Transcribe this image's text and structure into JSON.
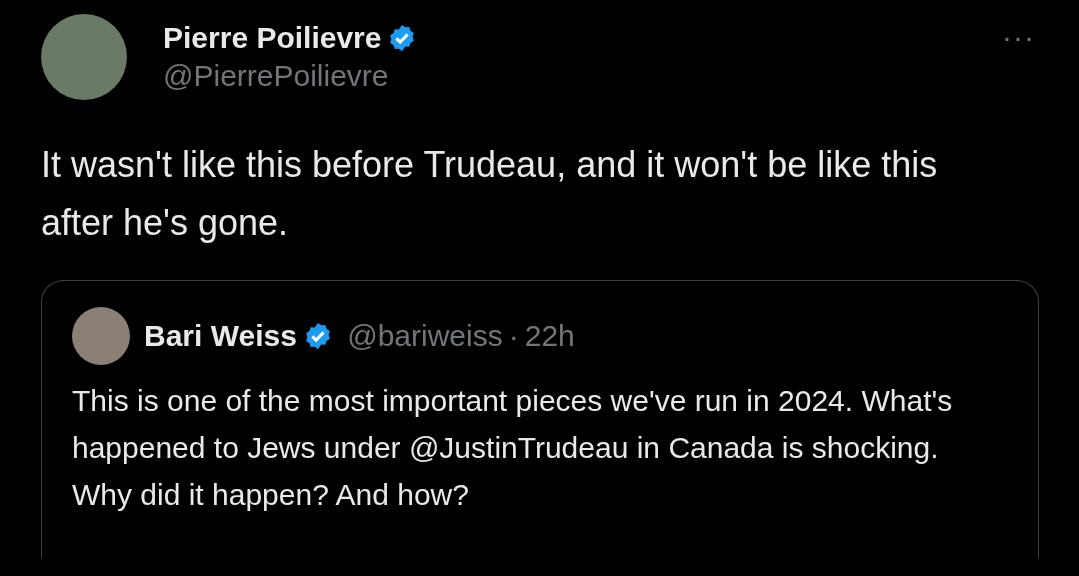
{
  "author": {
    "name": "Pierre Poilievre",
    "verified": true,
    "handle": "@PierrePoilievre"
  },
  "more": "···",
  "text": "It wasn't like this before Trudeau, and it won't be like this after he's gone.",
  "quote": {
    "name": "Bari Weiss",
    "verified": true,
    "handle": "@bariweiss",
    "separator": "·",
    "time": "22h",
    "text": "This is one of the most important pieces we've run in 2024. What's happened to Jews under @JustinTrudeau in Canada is shocking. Why did it happen? And how?"
  }
}
